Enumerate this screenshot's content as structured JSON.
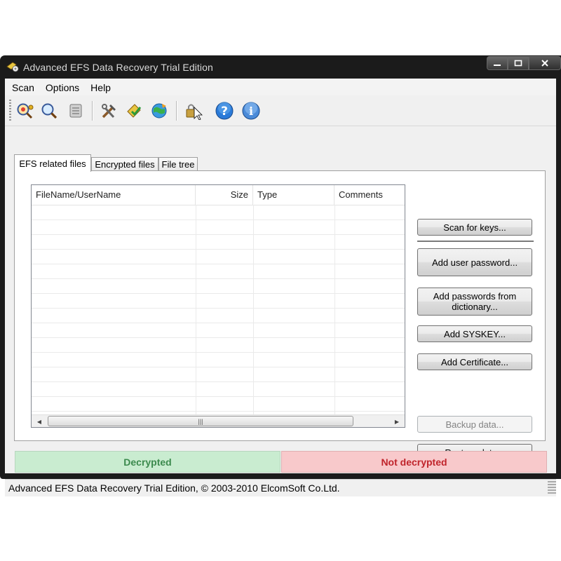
{
  "window": {
    "title": "Advanced EFS Data Recovery Trial Edition"
  },
  "menu": {
    "items": [
      "Scan",
      "Options",
      "Help"
    ]
  },
  "toolbar": {
    "icons": [
      "scan-keys-icon",
      "search-icon",
      "hdd-icon",
      "tools-icon",
      "decrypt-icon",
      "update-icon",
      "lock-cursor-icon",
      "help-icon",
      "info-icon"
    ]
  },
  "tabs": [
    "EFS related files",
    "Encrypted files",
    "File tree"
  ],
  "file_list": {
    "columns": [
      "FileName/UserName",
      "Size",
      "Type",
      "Comments"
    ],
    "rows": []
  },
  "buttons": {
    "scan_keys": "Scan for keys...",
    "add_user_password": "Add user password...",
    "add_passwords_dictionary": "Add passwords from dictionary...",
    "add_syskey": "Add SYSKEY...",
    "add_certificate": "Add Certificate...",
    "backup_data": "Backup data...",
    "restore_data": "Restore data..."
  },
  "status": {
    "decrypted": "Decrypted",
    "not_decrypted": "Not decrypted",
    "colors": {
      "decrypted_bg": "#c9ecd0",
      "decrypted_text": "#3c8a4e",
      "not_decrypted_bg": "#f8c9cb",
      "not_decrypted_text": "#c0242b"
    }
  },
  "statusbar": {
    "text": "Advanced EFS Data Recovery Trial Edition, © 2003-2010 ElcomSoft Co.Ltd."
  }
}
